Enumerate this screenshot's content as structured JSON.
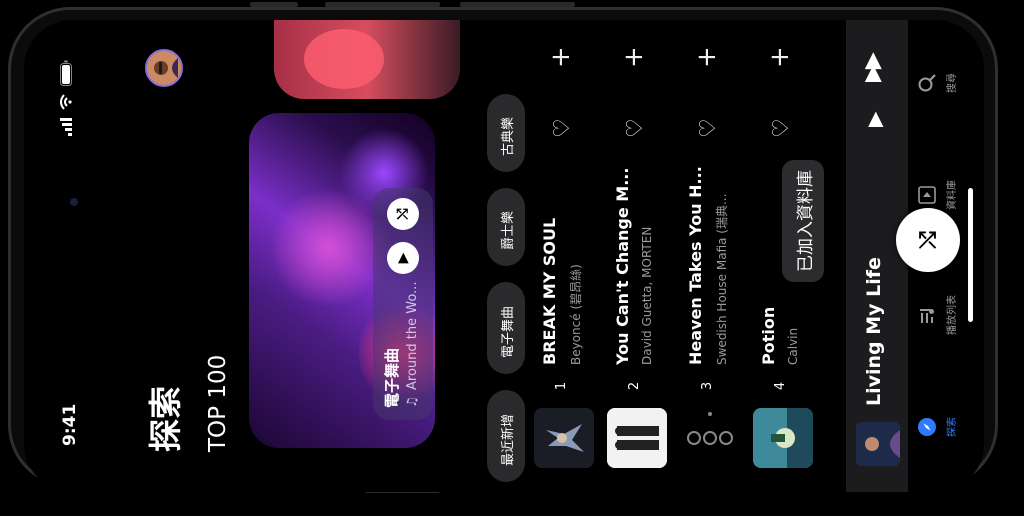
{
  "status": {
    "time": "9:41"
  },
  "page": {
    "title": "探索",
    "section": "TOP 100"
  },
  "hero": {
    "title": "電子舞曲",
    "subtitle": "Around the Wo..."
  },
  "chips": [
    {
      "label": "最近新增"
    },
    {
      "label": "電子舞曲"
    },
    {
      "label": "爵士樂"
    },
    {
      "label": "古典樂"
    }
  ],
  "songs": [
    {
      "rank": "1",
      "title": "BREAK MY SOUL",
      "artist": "Beyoncé (碧昂絲)"
    },
    {
      "rank": "2",
      "title": "You Can't Change M...",
      "artist": "David Guetta, MORTEN"
    },
    {
      "rank": "3",
      "title": "Heaven Takes You H...",
      "artist": "Swedish House Mafia (瑞典..."
    },
    {
      "rank": "4",
      "title": "Potion",
      "artist": "Calvin"
    }
  ],
  "toast": "已加入資料庫",
  "player": {
    "title": "Living My Life"
  },
  "tabs": [
    {
      "label": "探索"
    },
    {
      "label": "播放列表"
    },
    {
      "label": "資料庫"
    },
    {
      "label": "搜尋"
    }
  ],
  "colors": {
    "accent": "#2D7BFF",
    "background": "#000000",
    "chip": "#2A2A2C",
    "player": "#1C1C1E"
  }
}
